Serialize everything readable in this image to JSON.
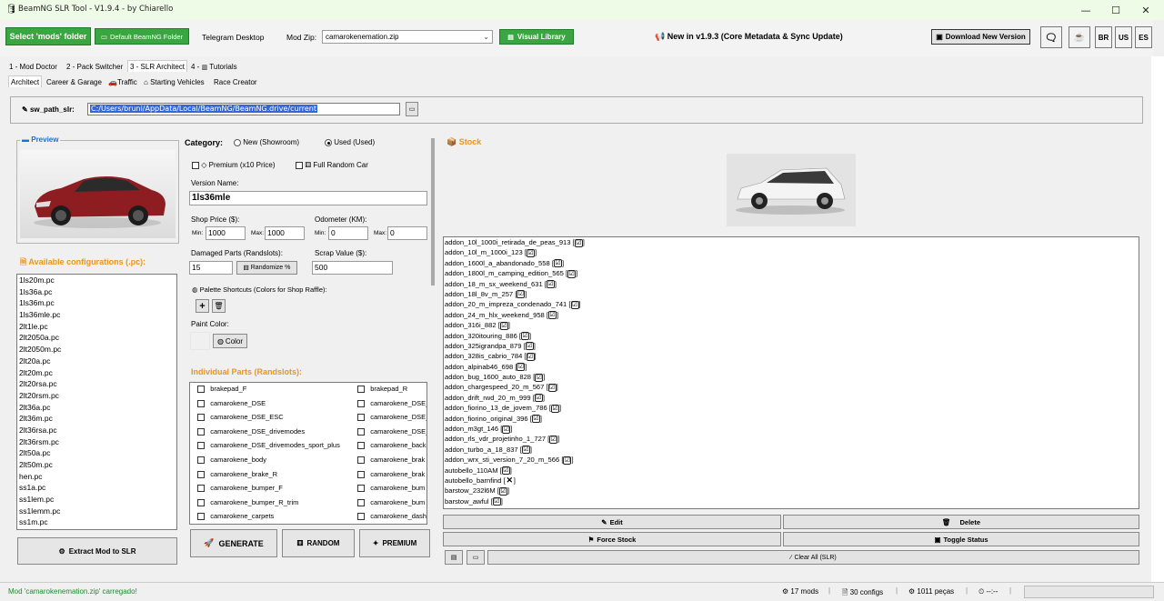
{
  "window": {
    "title": "BeamNG SLR Tool - V1.9.4 - by Chiarello",
    "icon": "app-icon"
  },
  "toolbar": {
    "select_mods": "Select 'mods' folder",
    "default_folder": "Default BeamNG Folder",
    "telegram": "Telegram Desktop",
    "mod_zip_label": "Mod Zip:",
    "mod_zip_value": "camarokenemation.zip",
    "visual_library": "Visual Library",
    "news": "New in v1.9.3 (Core Metadata & Sync Update)",
    "download": "Download New Version",
    "langs": [
      "BR",
      "US",
      "ES"
    ]
  },
  "tabs_main": [
    "1 - Mod Doctor",
    "2 - Pack Switcher",
    "3 - SLR Architect",
    "4 -",
    "Tutorials"
  ],
  "tabs_sub": [
    "Architect",
    "Career & Garage",
    "Traffic",
    "Starting Vehicles",
    "Race Creator"
  ],
  "path": {
    "label": "sw_path_slr:",
    "value": "C:/Users/bruni/AppData/Local/BeamNG/BeamNG.drive/current"
  },
  "preview": {
    "title": "Preview"
  },
  "configs": {
    "title": "Available configurations (.pc):",
    "items": [
      "1ls20m.pc",
      "1ls36a.pc",
      "1ls36m.pc",
      "1ls36mle.pc",
      "2lt1le.pc",
      "2lt2050a.pc",
      "2lt2050m.pc",
      "2lt20a.pc",
      "2lt20m.pc",
      "2lt20rsa.pc",
      "2lt20rsm.pc",
      "2lt36a.pc",
      "2lt36m.pc",
      "2lt36rsa.pc",
      "2lt36rsm.pc",
      "2lt50a.pc",
      "2lt50m.pc",
      "hen.pc",
      "ss1a.pc",
      "ss1lem.pc",
      "ss1lemm.pc",
      "ss1m.pc"
    ]
  },
  "extract_btn": "Extract Mod to SLR",
  "form": {
    "category_label": "Category:",
    "cat_new": "New (Showroom)",
    "cat_used": "Used (Used)",
    "premium": "Premium (x10 Price)",
    "full_random": "Full Random Car",
    "version_label": "Version Name:",
    "version_value": "1ls36mle",
    "shop_price_label": "Shop Price ($):",
    "odometer_label": "Odometer (KM):",
    "min": "Min:",
    "max": "Max:",
    "price_min": "1000",
    "price_max": "1000",
    "odo_min": "0",
    "odo_max": "0",
    "damaged_label": "Damaged Parts (Randslots):",
    "damaged_value": "15",
    "randomize": "Randomize %",
    "scrap_label": "Scrap Value ($):",
    "scrap_value": "500",
    "palette_label": "Palette Shortcuts (Colors for Shop Raffle):",
    "paint_label": "Paint Color:",
    "color_btn": "Color",
    "parts_title": "Individual Parts (Randslots):"
  },
  "parts_left": [
    "brakepad_F",
    "camarokene_DSE",
    "camarokene_DSE_ESC",
    "camarokene_DSE_drivemodes",
    "camarokene_DSE_drivemodes_sport_plus",
    "camarokene_body",
    "camarokene_brake_R",
    "camarokene_bumper_F",
    "camarokene_bumper_R_trim",
    "camarokene_carpets"
  ],
  "parts_right": [
    "brakepad_R",
    "camarokene_DSE_",
    "camarokene_DSE_",
    "camarokene_DSE_",
    "camarokene_back",
    "camarokene_brak",
    "camarokene_brak",
    "camarokene_bum",
    "camarokene_bum",
    "camarokene_dash"
  ],
  "actions": {
    "generate": "GENERATE",
    "random": "RANDOM",
    "premium": "PREMIUM"
  },
  "stock": {
    "title": "Stock",
    "items": [
      {
        "name": "addon_10l_1000i_retirada_de_peas_913",
        "ok": true
      },
      {
        "name": "addon_10l_m_1000i_123",
        "ok": true
      },
      {
        "name": "addon_1600l_a_abandonado_558",
        "ok": true
      },
      {
        "name": "addon_1800l_m_camping_edition_565",
        "ok": true
      },
      {
        "name": "addon_18_m_sx_weekend_631",
        "ok": true
      },
      {
        "name": "addon_18l_8v_m_257",
        "ok": true
      },
      {
        "name": "addon_20_m_impreza_condenado_741",
        "ok": true
      },
      {
        "name": "addon_24_m_hlx_weekend_958",
        "ok": true
      },
      {
        "name": "addon_316i_882",
        "ok": true
      },
      {
        "name": "addon_320itouring_886",
        "ok": true
      },
      {
        "name": "addon_325igrandpa_879",
        "ok": true
      },
      {
        "name": "addon_328is_cabrio_784",
        "ok": true
      },
      {
        "name": "addon_alpinab46_698",
        "ok": true
      },
      {
        "name": "addon_bug_1600_auto_828",
        "ok": true
      },
      {
        "name": "addon_chargespeed_20_m_567",
        "ok": true
      },
      {
        "name": "addon_drift_rwd_20_m_999",
        "ok": true
      },
      {
        "name": "addon_fiorino_13_de_jovem_786",
        "ok": true
      },
      {
        "name": "addon_fiorino_original_396",
        "ok": true
      },
      {
        "name": "addon_m3gt_146",
        "ok": true
      },
      {
        "name": "addon_rls_vdr_projetinho_1_727",
        "ok": true
      },
      {
        "name": "addon_turbo_a_18_837",
        "ok": true
      },
      {
        "name": "addon_wrx_sti_version_7_20_m_566",
        "ok": true
      },
      {
        "name": "autobello_110AM",
        "ok": true
      },
      {
        "name": "autobello_barnfind",
        "ok": false
      },
      {
        "name": "barstow_232l6M",
        "ok": true
      },
      {
        "name": "barstow_awful",
        "ok": true
      }
    ],
    "check_mark": "☑",
    "cross_mark": "✕",
    "edit": "Edit",
    "delete": "Delete",
    "force": "Force Stock",
    "toggle": "Toggle Status",
    "clear": "Clear All (SLR)"
  },
  "status": {
    "message": "Mod 'camarokenemation.zip' carregado!",
    "mods": "17 mods",
    "configs": "30 configs",
    "parts": "1011 peças",
    "time": "--:--"
  },
  "colors": {
    "green": "#3aa641",
    "orange": "#e8961e",
    "blue": "#1a6fd0"
  }
}
